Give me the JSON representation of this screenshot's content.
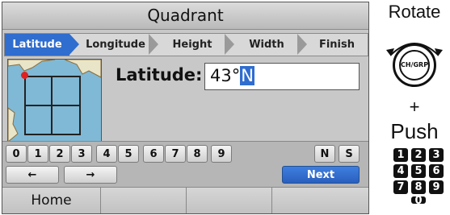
{
  "screen": {
    "title": "Quadrant",
    "steps": [
      "Latitude",
      "Longitude",
      "Height",
      "Width",
      "Finish"
    ],
    "active_step": "Latitude",
    "field": {
      "label": "Latitude:",
      "value": "43°",
      "cursor_char": "N"
    },
    "keypad": {
      "digits": [
        "0",
        "1",
        "2",
        "3",
        "4",
        "5",
        "6",
        "7",
        "8",
        "9"
      ],
      "hemisphere": [
        "N",
        "S"
      ],
      "left_arrow": "←",
      "right_arrow": "→",
      "next": "Next"
    },
    "softkeys": [
      "Home",
      "",
      "",
      ""
    ]
  },
  "side": {
    "rotate_label": "Rotate",
    "knob_label": "CH/GRP",
    "plus": "+",
    "push_label": "Push",
    "numbers": [
      "1",
      "2",
      "3",
      "4",
      "5",
      "6",
      "7",
      "8",
      "9",
      "0"
    ]
  },
  "colors": {
    "accent": "#2f6dcf",
    "map_water": "#7fb9d6",
    "marker": "#e02020"
  }
}
